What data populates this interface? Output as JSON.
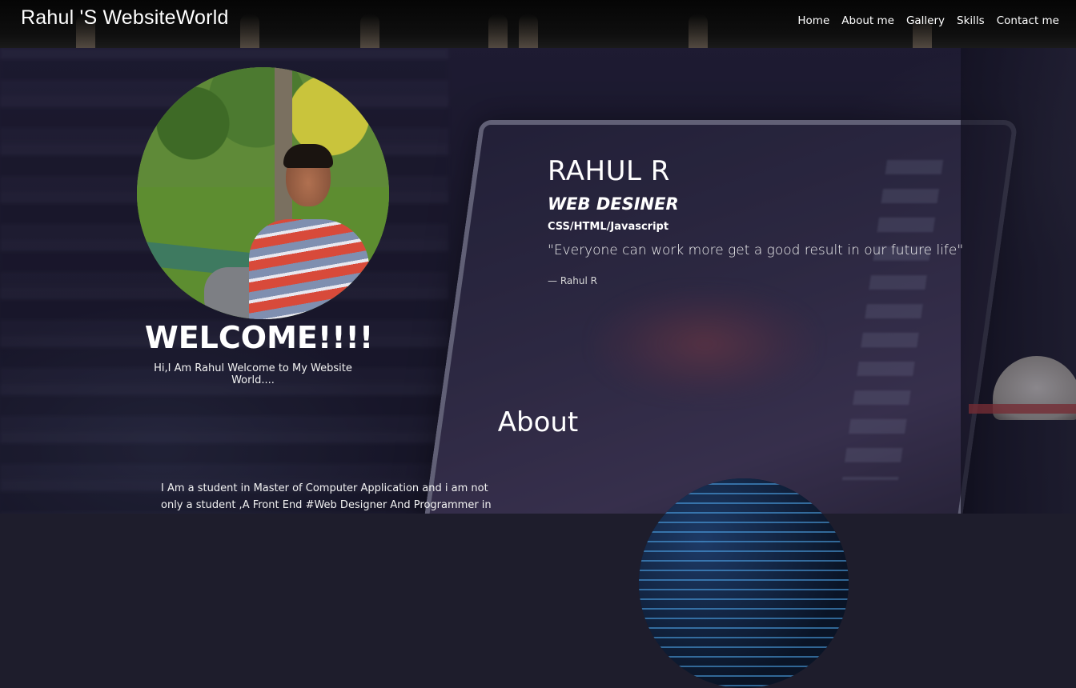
{
  "navbar": {
    "brand": "Rahul 'S WebsiteWorld",
    "menu": [
      "Home",
      "About me",
      "Gallery",
      "Skills",
      "Contact me"
    ]
  },
  "hero": {
    "welcome": "WELCOME!!!!",
    "welcome_sub": "Hi,I Am Rahul Welcome to My Website World....",
    "name": "RAHUL R",
    "role": "WEB DESINER",
    "skills": "CSS/HTML/Javascript",
    "quote": "\"Everyone can work more get a good result in our future life\"",
    "cite": "— Rahul R"
  },
  "about": {
    "title": "About",
    "text": "I Am a student in Master of Computer Application and i am not only a student ,A Front End #Web Designer And Programmer in"
  },
  "colors": {
    "navbar_bg": "#0a0a0a",
    "text": "#ffffff",
    "page_overlay": "#1e1d2c"
  }
}
